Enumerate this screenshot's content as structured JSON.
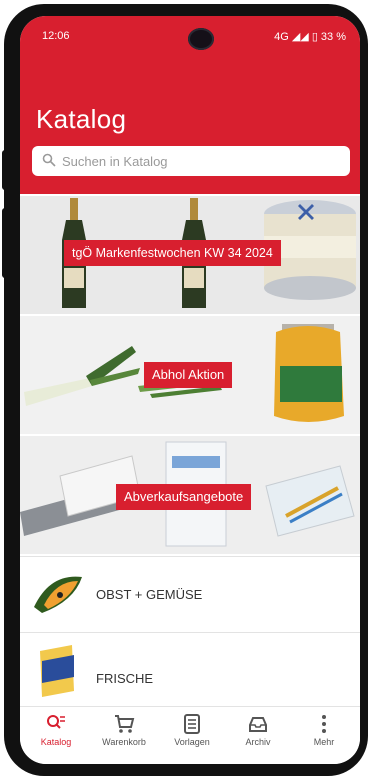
{
  "status": {
    "time": "12:06",
    "right": "4G ◢◢ ▯ 33 %"
  },
  "header": {
    "title": "Katalog"
  },
  "search": {
    "placeholder": "Suchen in Katalog"
  },
  "banners": [
    {
      "label": "tgÖ Markenfestwochen KW 34 2024"
    },
    {
      "label": "Abhol Aktion"
    },
    {
      "label": "Abverkaufsangebote"
    }
  ],
  "categories": [
    {
      "label": "OBST + GEMÜSE",
      "icon": "papaya-icon"
    },
    {
      "label": "FRISCHE",
      "icon": "butter-icon"
    }
  ],
  "nav": {
    "items": [
      {
        "label": "Katalog",
        "icon": "catalog-search-icon"
      },
      {
        "label": "Warenkorb",
        "icon": "cart-icon"
      },
      {
        "label": "Vorlagen",
        "icon": "template-icon"
      },
      {
        "label": "Archiv",
        "icon": "archive-icon"
      },
      {
        "label": "Mehr",
        "icon": "more-vertical-icon"
      }
    ]
  },
  "colors": {
    "brand": "#d81f2f"
  }
}
